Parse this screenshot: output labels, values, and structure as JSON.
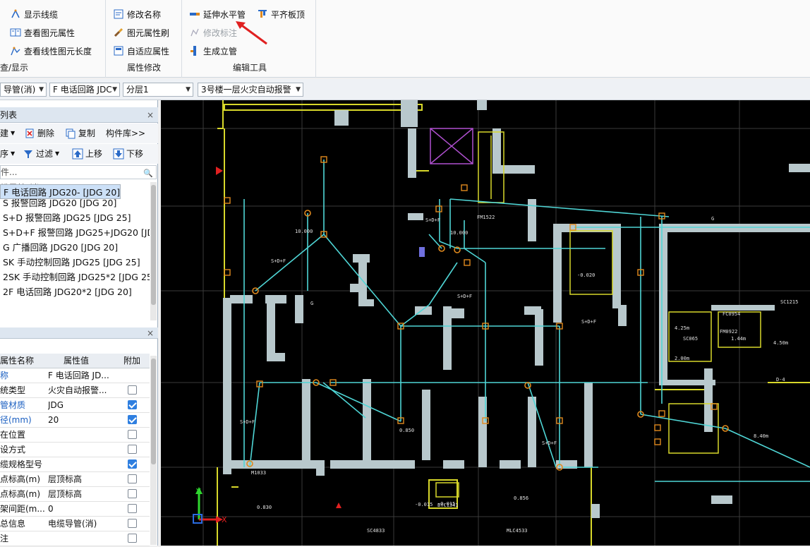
{
  "ribbon": {
    "view_group": {
      "show_lines": "显示线缆",
      "view_props": "查看图元属性",
      "view_line_length": "查看线性图元长度",
      "title": "查/显示"
    },
    "attr_group": {
      "rename": "修改名称",
      "attr_brush": "图元属性刷",
      "adaptive_attr": "自适应属性",
      "title": "属性修改"
    },
    "edit_group": {
      "extend_horizontal": "延伸水平管",
      "flush_top": "平齐板顶",
      "modify_label": "修改标注",
      "gen_riser": "生成立管",
      "title": "编辑工具"
    }
  },
  "selectors": {
    "type": "导管(消)",
    "component": "F 电话回路 JDC",
    "layer": "分层1",
    "drawing": "3号楼一层火灾自动报警"
  },
  "component_list": {
    "title": "列表",
    "toolbar": {
      "new": "建",
      "delete": "删除",
      "copy": "复制",
      "library": "构件库>>",
      "sort": "序",
      "filter": "过滤",
      "up": "上移",
      "down": "下移"
    },
    "search_placeholder": "件...",
    "tree": [
      "缆导管(消)",
      "S 报警回路 JDG20 [JDG 20]",
      "S+D 报警回路 JDG25 [JDG 25]",
      "S+D+F 报警回路 JDG25+JDG20 [JDG",
      "G 广播回路 JDG20 [JDG 20]",
      "SK 手动控制回路 JDG25 [JDG 25]",
      "2SK 手动控制回路 JDG25*2 [JDG 25]",
      "F 电话回路 JDG20- [JDG 20]",
      "2F 电话回路 JDG20*2 [JDG 20]"
    ],
    "selected_index": 7
  },
  "properties": {
    "headers": {
      "name": "属性名称",
      "value": "属性值",
      "extra": "附加"
    },
    "rows": [
      {
        "name": "称",
        "value": "F 电话回路 JD...",
        "checkbox": null,
        "blue": true
      },
      {
        "name": "统类型",
        "value": "火灾自动报警...",
        "checkbox": false,
        "blue": false
      },
      {
        "name": "管材质",
        "value": "JDG",
        "checkbox": true,
        "blue": true
      },
      {
        "name": "径(mm)",
        "value": "20",
        "checkbox": true,
        "blue": true
      },
      {
        "name": "在位置",
        "value": "",
        "checkbox": false,
        "blue": false
      },
      {
        "name": "设方式",
        "value": "",
        "checkbox": false,
        "blue": false
      },
      {
        "name": "缆规格型号",
        "value": "",
        "checkbox": true,
        "blue": false
      },
      {
        "name": "点标高(m)",
        "value": "层顶标高",
        "checkbox": false,
        "blue": false
      },
      {
        "name": "点标高(m)",
        "value": "层顶标高",
        "checkbox": false,
        "blue": false
      },
      {
        "name": "架间距(m...",
        "value": "0",
        "checkbox": false,
        "blue": false
      },
      {
        "name": "总信息",
        "value": "电缆导管(消)",
        "checkbox": false,
        "blue": false
      },
      {
        "name": "注",
        "value": "",
        "checkbox": false,
        "blue": false
      }
    ]
  },
  "drawing": {
    "labels": [
      "S+D+F",
      "S+D+F",
      "S+D+F",
      "S+D+F",
      "S+D+F",
      "S+D+F",
      "G",
      "G",
      "0.850",
      "0.830",
      "0.856",
      "-0.015",
      "10.000",
      "10.000",
      "4.25m",
      "2.00m",
      "1.44m",
      "4.50m",
      "8.40m",
      "D-4",
      "SC4833",
      "MLC4533",
      "BYC1341",
      "M1033",
      "FM1522",
      "SC1215",
      "FM0922",
      "SC065",
      "FC0954",
      "-0.020",
      "-0.015"
    ],
    "axis_x": "X",
    "axis_y": "Y"
  },
  "colors": {
    "cyan_lines": "#4fd6d6",
    "wall_fill": "#b8c8cc",
    "yellow_lines": "#d8d82a",
    "red_arrow": "#e02020"
  }
}
